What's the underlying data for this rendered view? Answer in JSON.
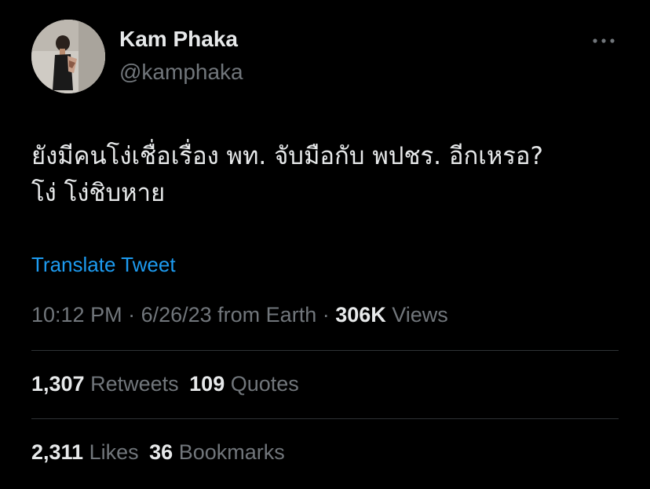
{
  "author": {
    "display_name": "Kam Phaka",
    "handle": "@kamphaka"
  },
  "more_icon": "more-horizontal-icon",
  "tweet": {
    "line1": "ยังมีคนโง่เชื่อเรื่อง พท. จับมือกับ พปชร. อีกเหรอ?",
    "line2": "โง่ โง่ชิบหาย"
  },
  "translate_label": "Translate Tweet",
  "meta": {
    "time": "10:12 PM",
    "sep1": " · ",
    "date": "6/26/23",
    "source": " from Earth",
    "sep2": " · ",
    "views_count": "306K",
    "views_label": " Views"
  },
  "stats_row1": {
    "retweets_count": "1,307",
    "retweets_label": " Retweets",
    "quotes_count": "109",
    "quotes_label": " Quotes"
  },
  "stats_row2": {
    "likes_count": "2,311",
    "likes_label": " Likes",
    "bookmarks_count": "36",
    "bookmarks_label": " Bookmarks"
  },
  "colors": {
    "background": "#000000",
    "primary_text": "#e7e9ea",
    "secondary_text": "#71767b",
    "link": "#1d9bf0",
    "divider": "#2f3336"
  }
}
